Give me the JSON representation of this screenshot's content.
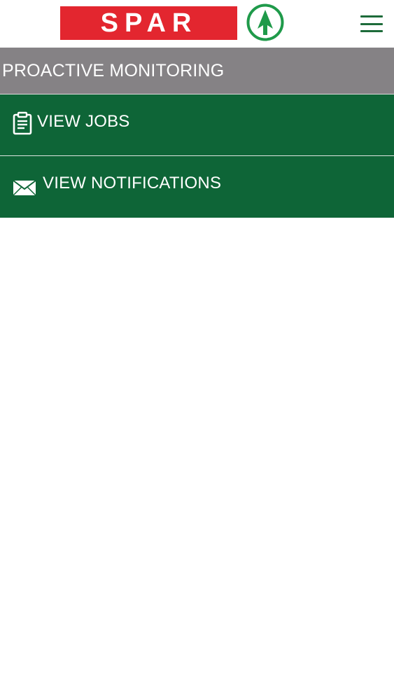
{
  "header": {
    "brand_wordmark": "SPAR",
    "logo_icon": "spar-tree-icon",
    "menu_icon": "hamburger-menu-icon"
  },
  "section": {
    "title": "PROACTIVE MONITORING"
  },
  "menu": {
    "items": [
      {
        "label": "VIEW JOBS",
        "icon": "clipboard-icon"
      },
      {
        "label": "VIEW NOTIFICATIONS",
        "icon": "envelope-icon"
      }
    ]
  },
  "colors": {
    "brand_red": "#e3262f",
    "brand_green": "#1d6b3a",
    "menu_green": "#0e6537",
    "section_gray": "#858285",
    "text_white": "#ffffff"
  }
}
